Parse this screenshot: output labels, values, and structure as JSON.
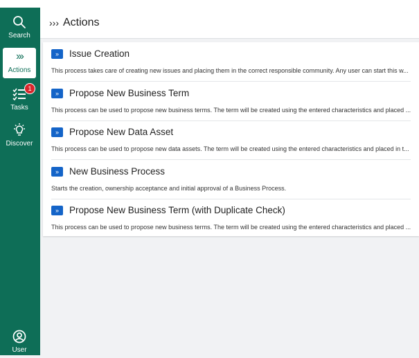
{
  "header": {
    "icon": "chevrons-right-icon",
    "icon_glyph": "›››",
    "title": "Actions"
  },
  "sidebar": {
    "items": [
      {
        "label": "Search",
        "icon": "search-icon"
      },
      {
        "label": "Actions",
        "icon": "chevrons-right-icon",
        "icon_glyph": "›››",
        "active": true
      },
      {
        "label": "Tasks",
        "icon": "tasks-icon",
        "badge": "1"
      },
      {
        "label": "Discover",
        "icon": "lightbulb-icon"
      },
      {
        "label": "User",
        "icon": "user-icon"
      }
    ]
  },
  "actions": [
    {
      "chip": "»",
      "title": "Issue Creation",
      "description": "This process takes care of creating new issues and placing them in the correct responsible community. Any user can start this w..."
    },
    {
      "chip": "»",
      "title": "Propose New Business Term",
      "description": "This process can be used to propose new business terms. The term will be created using the entered characteristics and placed ..."
    },
    {
      "chip": "»",
      "title": "Propose New Data Asset",
      "description": "This process can be used to propose new data assets. The term will be created using the entered characteristics and placed in t..."
    },
    {
      "chip": "»",
      "title": "New Business Process",
      "description": "Starts the creation, ownership acceptance and initial approval of a Business Process."
    },
    {
      "chip": "»",
      "title": "Propose New Business Term (with Duplicate Check)",
      "description": "This process can be used to propose new business terms. The term will be created using the entered characteristics and placed ..."
    }
  ],
  "colors": {
    "sidebar": "#0e6e57",
    "chip": "#1464c8",
    "badge": "#d8262c"
  }
}
